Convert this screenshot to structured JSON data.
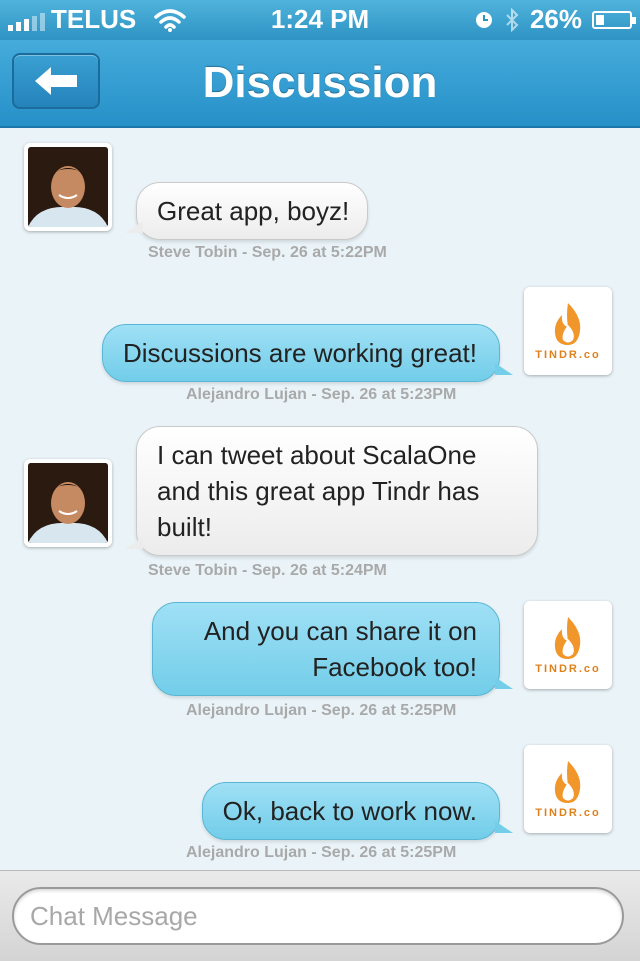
{
  "status_bar": {
    "carrier": "TELUS",
    "time": "1:24 PM",
    "battery": "26%",
    "battery_level": 0.26
  },
  "nav": {
    "title": "Discussion",
    "back_icon": "back-arrow-icon"
  },
  "messages": [
    {
      "direction": "incoming",
      "text": "Great app, boyz!",
      "meta": "Steve Tobin - Sep. 26 at 5:22PM"
    },
    {
      "direction": "outgoing",
      "text": "Discussions are working great!",
      "meta": "Alejandro Lujan - Sep. 26 at 5:23PM"
    },
    {
      "direction": "incoming",
      "text": "I can tweet about ScalaOne and this great app Tindr has built!",
      "meta": "Steve Tobin - Sep. 26 at 5:24PM"
    },
    {
      "direction": "outgoing",
      "text": "And you can share it on Facebook too!",
      "meta": "Alejandro Lujan - Sep. 26 at 5:25PM"
    },
    {
      "direction": "outgoing",
      "text": "Ok, back to work now.",
      "meta": "Alejandro Lujan - Sep. 26 at 5:25PM"
    }
  ],
  "logo": {
    "text": "TINDR.co",
    "icon": "flame-icon"
  },
  "compose": {
    "placeholder": "Chat Message"
  },
  "colors": {
    "nav_blue": "#2f93c4",
    "outgoing_bubble": "#7fd3ec",
    "incoming_bubble": "#f2f2f2",
    "meta_text": "#a9a9a9"
  }
}
